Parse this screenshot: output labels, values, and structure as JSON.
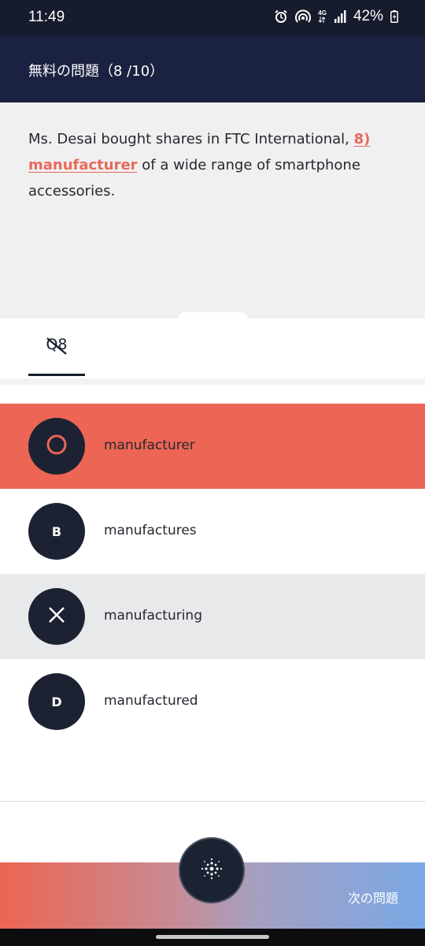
{
  "status_bar": {
    "time": "11:49",
    "network": "4G",
    "battery": "42%"
  },
  "header": {
    "title": "無料の問題（8 /10）"
  },
  "question": {
    "before": "Ms. Desai bought shares in FTC International, ",
    "highlight": "8) manufacturer",
    "after": " of a wide range of smartphone accessories."
  },
  "tab": {
    "label": "Q8"
  },
  "options": [
    {
      "marker": "correct-icon",
      "text": "manufacturer",
      "state": "correct",
      "bg": "#ec6555"
    },
    {
      "marker": "B",
      "text": "manufactures",
      "state": "normal",
      "bg": "#ffffff"
    },
    {
      "marker": "wrong-icon",
      "text": "manufacturing",
      "state": "wrong",
      "bg": "#e8e9eb"
    },
    {
      "marker": "D",
      "text": "manufactured",
      "state": "normal",
      "bg": "#ffffff"
    }
  ],
  "footer": {
    "next_label": "次の問題",
    "fab_icon": "sparkle-icon"
  },
  "colors": {
    "header_bg": "#1b2140",
    "accent_correct": "#ec6555",
    "accent_blue": "#7aa8e6"
  }
}
